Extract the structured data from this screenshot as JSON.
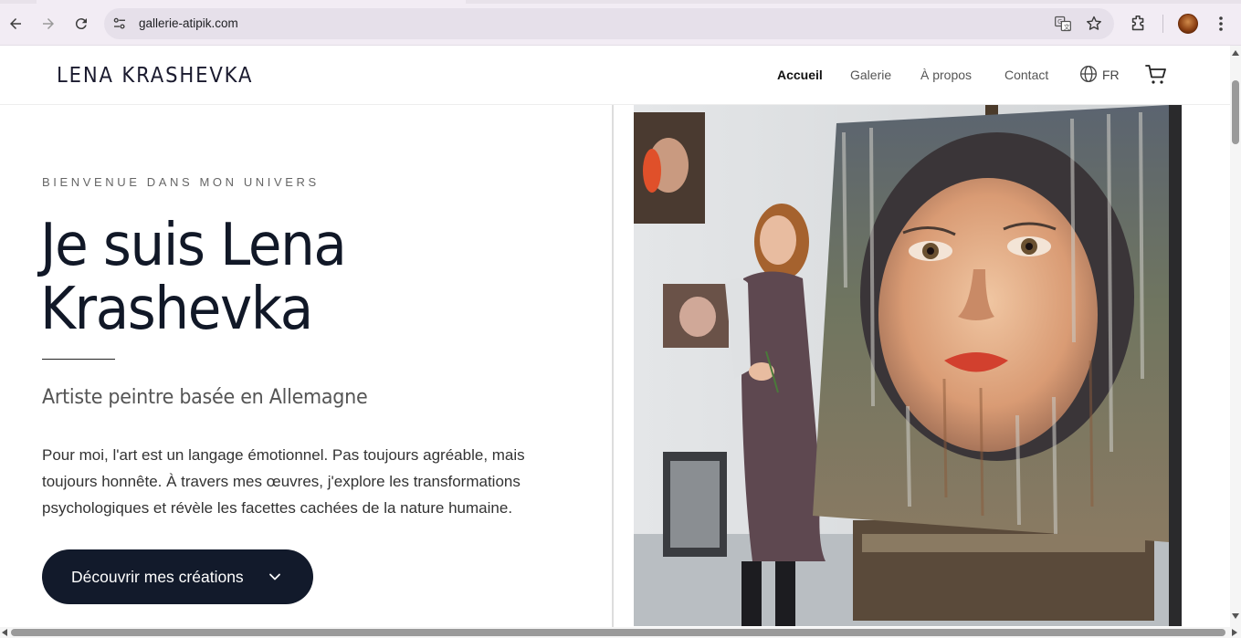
{
  "browser": {
    "url": "gallerie-atipik.com",
    "icons": [
      "back-arrow-icon",
      "forward-arrow-icon",
      "reload-icon",
      "site-settings-icon",
      "translate-icon",
      "bookmark-star-icon",
      "extensions-icon",
      "profile-avatar",
      "menu-kebab-icon"
    ]
  },
  "header": {
    "logo": "LENA KRASHEVKA",
    "nav": [
      {
        "label": "Accueil",
        "active": true
      },
      {
        "label": "Galerie",
        "active": false
      },
      {
        "label": "À propos",
        "active": false
      },
      {
        "label": "Contact",
        "active": false
      }
    ],
    "language": "FR"
  },
  "hero": {
    "eyebrow": "BIENVENUE DANS MON UNIVERS",
    "title_line1": "Je suis Lena",
    "title_line2": "Krashevka",
    "subtitle": "Artiste peintre basée en Allemagne",
    "description_line1": "Pour moi, l'art est un langage émotionnel. Pas toujours agréable, mais",
    "description_line2": "toujours honnête. À travers mes œuvres, j'explore les transformations",
    "description_line3": "psychologiques et révèle les facettes cachées de la nature humaine.",
    "cta_label": "Découvrir mes créations"
  },
  "colors": {
    "cta_background": "#121a2b",
    "chrome_background": "#f2ecf4",
    "title_text": "#111827"
  }
}
